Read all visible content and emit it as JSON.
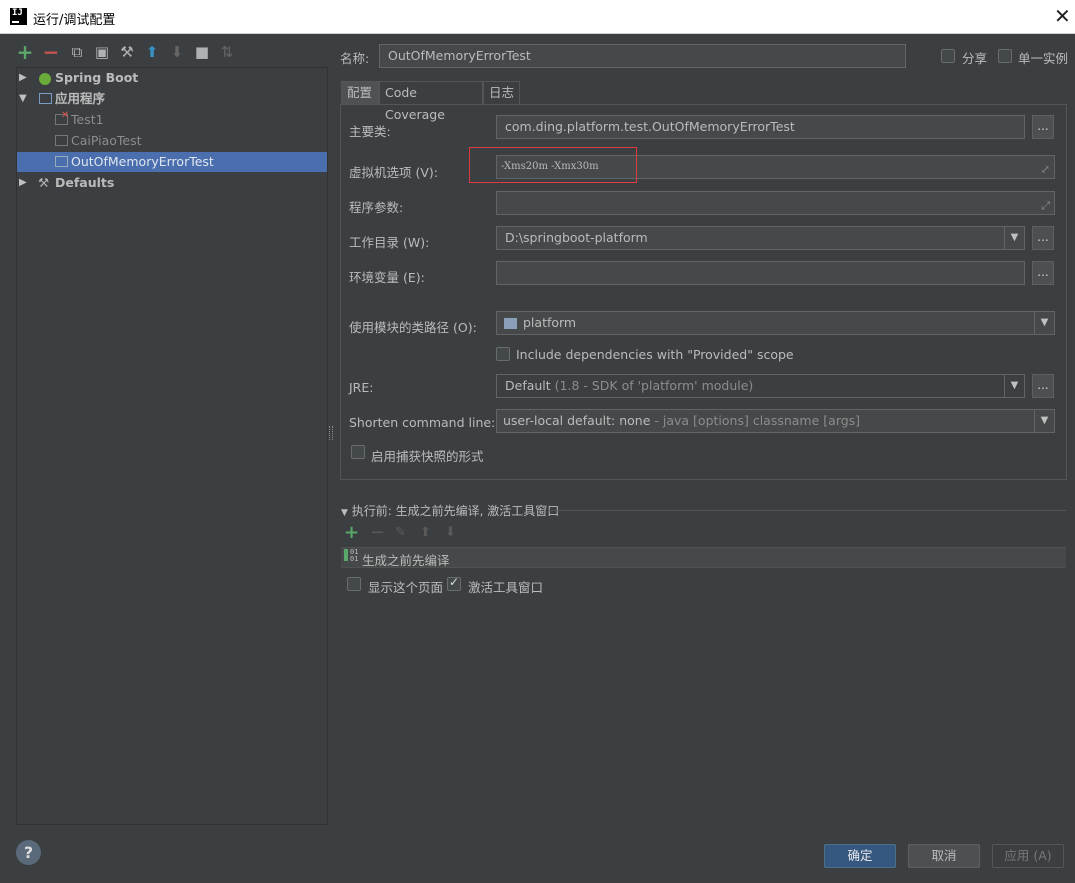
{
  "window": {
    "title": "运行/调试配置",
    "close": "✕"
  },
  "left_toolbar": [
    {
      "name": "add-icon",
      "glyph": "+",
      "color": "#59a869"
    },
    {
      "name": "remove-icon",
      "glyph": "−",
      "color": "#c75450"
    },
    {
      "name": "copy-icon",
      "glyph": "⧉",
      "color": "#afb1b3"
    },
    {
      "name": "save-icon",
      "glyph": "▣",
      "color": "#afb1b3"
    },
    {
      "name": "wrench-icon",
      "glyph": "⚒",
      "color": "#afb1b3"
    },
    {
      "name": "move-up-icon",
      "glyph": "⬆",
      "color": "#3592c4"
    },
    {
      "name": "move-down-icon",
      "glyph": "⬇",
      "color": "#666666"
    },
    {
      "name": "folder-icon",
      "glyph": "■",
      "color": "#afb1b3"
    },
    {
      "name": "sort-icon",
      "glyph": "⇅",
      "color": "#666666"
    }
  ],
  "tree": {
    "spring_boot": "Spring Boot",
    "application": "应用程序",
    "children": [
      "Test1",
      "CaiPiaoTest",
      "OutOfMemoryErrorTest"
    ],
    "defaults": "Defaults"
  },
  "header": {
    "name_label": "名称:",
    "name_value": "OutOfMemoryErrorTest",
    "share_label": "分享",
    "single_instance_label": "单一实例"
  },
  "tabs": [
    "配置",
    "Code Coverage",
    "日志"
  ],
  "form": {
    "main_class_label": "主要类:",
    "main_class_value": "com.ding.platform.test.OutOfMemoryErrorTest",
    "vm_options_label": "虚拟机选项 (V):",
    "vm_options_value": "-Xms20m -Xmx30m",
    "program_args_label": "程序参数:",
    "program_args_value": "",
    "working_dir_label": "工作目录 (W):",
    "working_dir_value": "D:\\springboot-platform",
    "env_vars_label": "环境变量 (E):",
    "env_vars_value": "",
    "module_classpath_label": "使用模块的类路径 (O):",
    "module_value": "platform",
    "include_provided_label": "Include dependencies with \"Provided\" scope",
    "jre_label": "JRE:",
    "jre_value": "Default",
    "jre_hint": " (1.8 - SDK of 'platform' module)",
    "shorten_label": "Shorten command line:",
    "shorten_value": "user-local default: none",
    "shorten_hint": " - java [options] classname [args]",
    "snapshot_label": "启用捕获快照的形式",
    "ellipsis": "...",
    "dropdown_arrow": "▼",
    "expand_glyph": "⤢"
  },
  "before_launch": {
    "header": "执行前: 生成之前先编译, 激活工具窗口",
    "task": "生成之前先编译",
    "show_page_label": "显示这个页面",
    "show_page_checked": false,
    "activate_window_label": "激活工具窗口",
    "activate_window_checked": true
  },
  "buttons": {
    "ok": "确定",
    "cancel": "取消",
    "apply": "应用 (A)",
    "help": "?"
  }
}
